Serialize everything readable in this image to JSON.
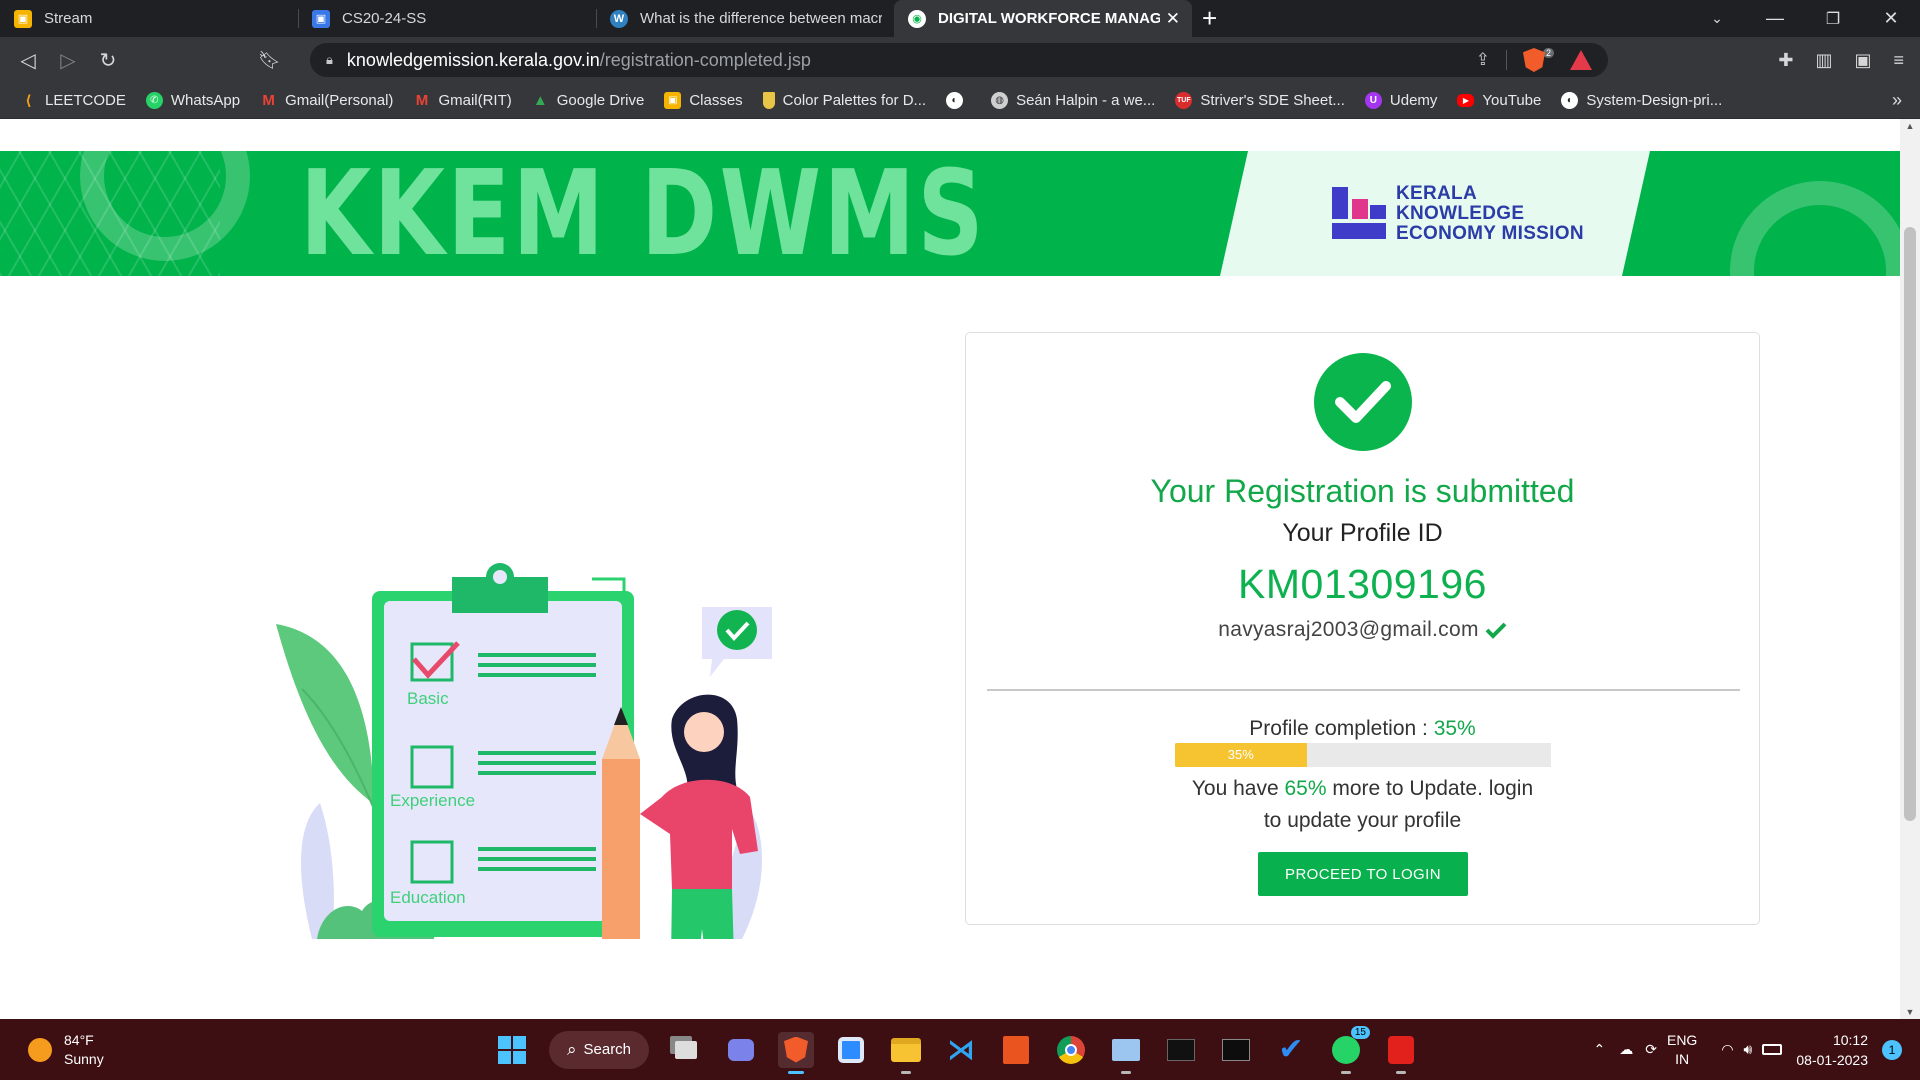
{
  "browser": {
    "tabs": [
      {
        "title": "Stream",
        "icon": "google-classroom-icon",
        "color": "#f4b400",
        "active": false
      },
      {
        "title": "CS20-24-SS",
        "icon": "google-classroom-icon",
        "color": "#3b78e7",
        "active": false
      },
      {
        "title": "What is the difference between macro",
        "icon": "wordpress-icon",
        "color": "#2f81c1",
        "active": false
      },
      {
        "title": "DIGITAL WORKFORCE MANAGEM",
        "icon": "kkem-icon",
        "color": "#ffffff",
        "active": true
      }
    ],
    "url_host": "knowledgemission.kerala.gov.in",
    "url_path": "/registration-completed.jsp",
    "shield_count": "2",
    "bookmarks": [
      {
        "label": "LEETCODE",
        "icon": "leetcode-icon",
        "color": "#f89f1b"
      },
      {
        "label": "WhatsApp",
        "icon": "whatsapp-icon",
        "color": "#25d366"
      },
      {
        "label": "Gmail(Personal)",
        "icon": "gmail-icon",
        "color": "#ea4335"
      },
      {
        "label": "Gmail(RIT)",
        "icon": "gmail-icon",
        "color": "#ea4335"
      },
      {
        "label": "Google Drive",
        "icon": "google-drive-icon",
        "color": "#34a853"
      },
      {
        "label": "Classes",
        "icon": "google-classroom-icon",
        "color": "#f4b400"
      },
      {
        "label": "Color Palettes for D...",
        "icon": "palette-icon",
        "color": "#e8c547"
      },
      {
        "label": "",
        "icon": "github-icon",
        "color": "#ffffff"
      },
      {
        "label": "Seán Halpin - a we...",
        "icon": "globe-icon",
        "color": "#cfcfcf"
      },
      {
        "label": "Striver's SDE Sheet...",
        "icon": "tuf-icon",
        "color": "#d92c2c"
      },
      {
        "label": "Udemy",
        "icon": "udemy-icon",
        "color": "#a435f0"
      },
      {
        "label": "YouTube",
        "icon": "youtube-icon",
        "color": "#ff0000"
      },
      {
        "label": "System-Design-pri...",
        "icon": "github-icon",
        "color": "#ffffff"
      }
    ]
  },
  "hero": {
    "title": "KKEM DWMS",
    "org_line1": "KERALA",
    "org_line2": "KNOWLEDGE",
    "org_line3": "ECONOMY MISSION",
    "colors": {
      "banner": "#00b34a",
      "title": "#6fe29c",
      "org": "#2b3ca8"
    }
  },
  "illustration": {
    "items": [
      "Basic",
      "Experience",
      "Education"
    ]
  },
  "result": {
    "title": "Your Registration is submitted",
    "profile_label": "Your Profile ID",
    "profile_id": "KM01309196",
    "email": "navyasraj2003@gmail.com",
    "completion_label": "Profile completion :",
    "completion_value": "35%",
    "progress_fraction": 0.35,
    "progress_label": "35%",
    "update_prefix": "You have",
    "update_pct": "65%",
    "update_suffix": "more to Update. login",
    "update_line2": "to update your profile",
    "button_label": "PROCEED TO LOGIN",
    "accent": "#08b14d"
  },
  "taskbar": {
    "temperature": "84°F",
    "condition": "Sunny",
    "search_label": "Search",
    "whatsapp_badge": "15",
    "lang_line1": "ENG",
    "lang_line2": "IN",
    "time": "10:12",
    "date": "08-01-2023",
    "notifications": "1"
  }
}
